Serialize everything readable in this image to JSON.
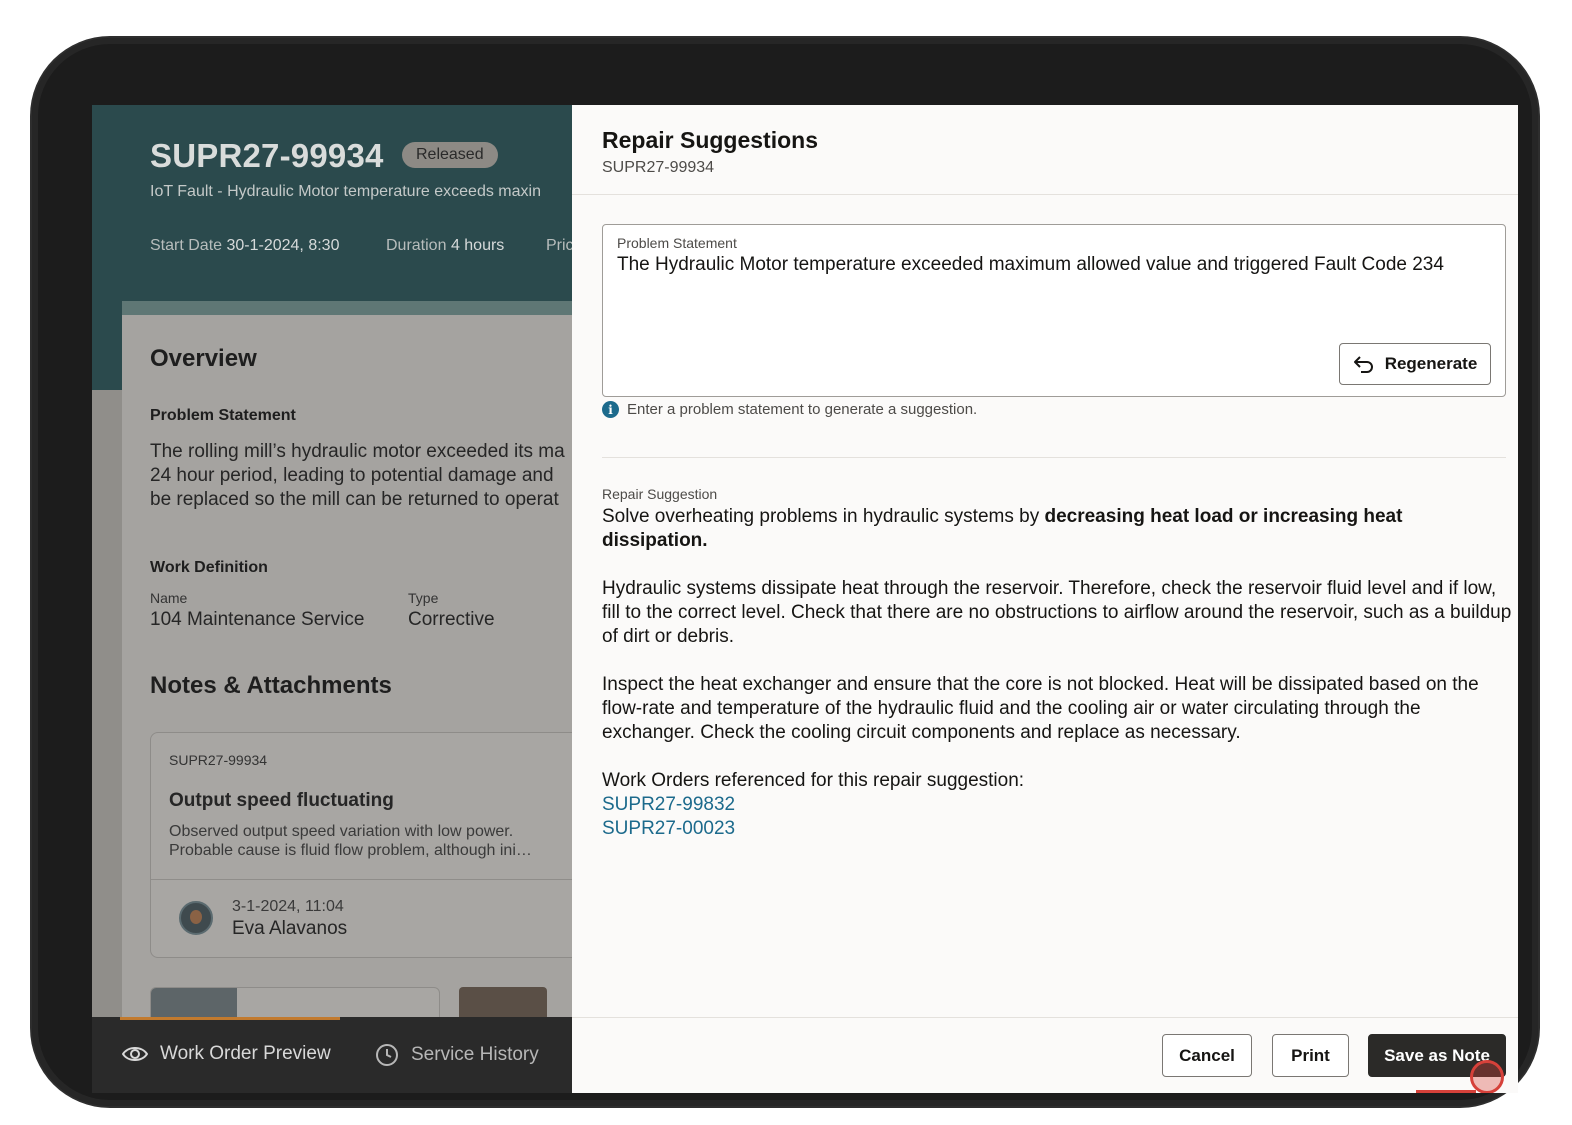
{
  "work_order": {
    "id": "SUPR27-99934",
    "status": "Released",
    "subtitle": "IoT Fault - Hydraulic Motor temperature exceeds maxin",
    "start_label": "Start Date",
    "start_value": "30-1-2024, 8:30",
    "duration_label": "Duration",
    "duration_value": "4 hours",
    "priority_label": "Pric"
  },
  "overview": {
    "heading": "Overview",
    "problem_label": "Problem Statement",
    "problem_lines": [
      "The rolling mill’s hydraulic motor exceeded its ma",
      "24 hour period, leading to potential damage and",
      "be replaced so the mill can be returned to operat"
    ],
    "work_definition_label": "Work Definition",
    "name_label": "Name",
    "name_value": "104 Maintenance Service",
    "type_label": "Type",
    "type_value": "Corrective"
  },
  "notes": {
    "heading": "Notes & Attachments",
    "card": {
      "ref": "SUPR27-99934",
      "title": "Output speed fluctuating",
      "desc_lines": [
        "Observed output speed variation with low power.",
        "Probable cause is fluid flow problem, although ini…"
      ],
      "date": "3-1-2024, 11:04",
      "author": "Eva Alavanos"
    }
  },
  "bottom_nav": {
    "preview": "Work Order Preview",
    "history": "Service History"
  },
  "drawer": {
    "title": "Repair Suggestions",
    "subtitle": "SUPR27-99934",
    "problem_label": "Problem Statement",
    "problem_value": "The Hydraulic Motor temperature exceeded maximum allowed value and triggered Fault Code 234",
    "regenerate_label": "Regenerate",
    "hint": "Enter a problem statement to generate a suggestion.",
    "suggestion_label": "Repair Suggestion",
    "suggestion_intro": "Solve overheating problems in hydraulic systems by ",
    "suggestion_intro_bold": "decreasing heat load or increasing heat dissipation.",
    "paragraph_1": "Hydraulic systems dissipate heat through the reservoir. Therefore, check the reservoir fluid level and if low, fill to the correct level. Check that there are no obstructions to airflow around the reservoir, such as a buildup of dirt or debris.",
    "paragraph_2": "Inspect the heat exchanger and ensure that the core is not blocked. Heat will be dissipated based on the flow-rate and temperature of the hydraulic fluid and the cooling air or water circulating through the exchanger. Check the cooling circuit components and replace as necessary.",
    "references_label": "Work Orders referenced for this repair suggestion:",
    "references": [
      "SUPR27-99832",
      "SUPR27-00023"
    ],
    "cancel_label": "Cancel",
    "print_label": "Print",
    "save_label": "Save as Note"
  },
  "icons": {
    "eye": "eye-icon",
    "clock": "clock-icon",
    "undo": "undo-arrow-icon",
    "info": "info-icon"
  },
  "colors": {
    "header_teal": "#2b4a4d",
    "link_blue": "#1c6a8c",
    "primary_button": "#2b2a28"
  }
}
